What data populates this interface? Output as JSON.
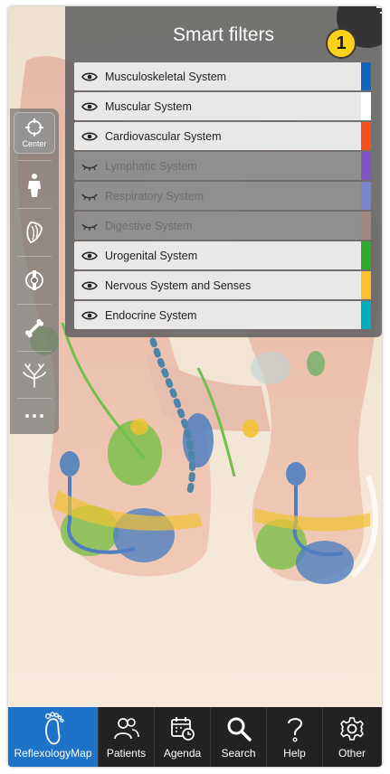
{
  "panel": {
    "title": "Smart filters",
    "step_badge": "1",
    "filters": [
      {
        "label": "Musculoskeletal System",
        "visible": true,
        "color": "#1565c0"
      },
      {
        "label": "Muscular System",
        "visible": true,
        "color": "#ffffff"
      },
      {
        "label": "Cardiovascular System",
        "visible": true,
        "color": "#f4511e"
      },
      {
        "label": "Lymphatic System",
        "visible": false,
        "color": "#7e57c2"
      },
      {
        "label": "Respiratory System",
        "visible": false,
        "color": "#7986cb"
      },
      {
        "label": "Digestive System",
        "visible": false,
        "color": "#a1887f"
      },
      {
        "label": "Urogenital System",
        "visible": true,
        "color": "#2eaa2e"
      },
      {
        "label": "Nervous System and Senses",
        "visible": true,
        "color": "#fbc02d"
      },
      {
        "label": "Endocrine System",
        "visible": true,
        "color": "#00acc1"
      }
    ]
  },
  "rail": {
    "center_label": "Center",
    "tools": [
      "crosshair-icon",
      "body-icon",
      "muscle-icon",
      "spine-icon",
      "bone-icon",
      "nerve-tree-icon",
      "more-icon"
    ]
  },
  "tabbar": {
    "tabs": [
      {
        "label": "ReflexologyMap",
        "icon": "foot-icon",
        "active": true
      },
      {
        "label": "Patients",
        "icon": "patients-icon",
        "active": false
      },
      {
        "label": "Agenda",
        "icon": "calendar-icon",
        "active": false
      },
      {
        "label": "Search",
        "icon": "search-icon",
        "active": false
      },
      {
        "label": "Help",
        "icon": "help-icon",
        "active": false
      },
      {
        "label": "Other",
        "icon": "gear-icon",
        "active": false
      }
    ]
  },
  "colors": {
    "accent": "#1e73c8",
    "badge": "#ffd21a",
    "panel_bg": "#5f5f5f",
    "tabbar_bg": "#222222"
  }
}
